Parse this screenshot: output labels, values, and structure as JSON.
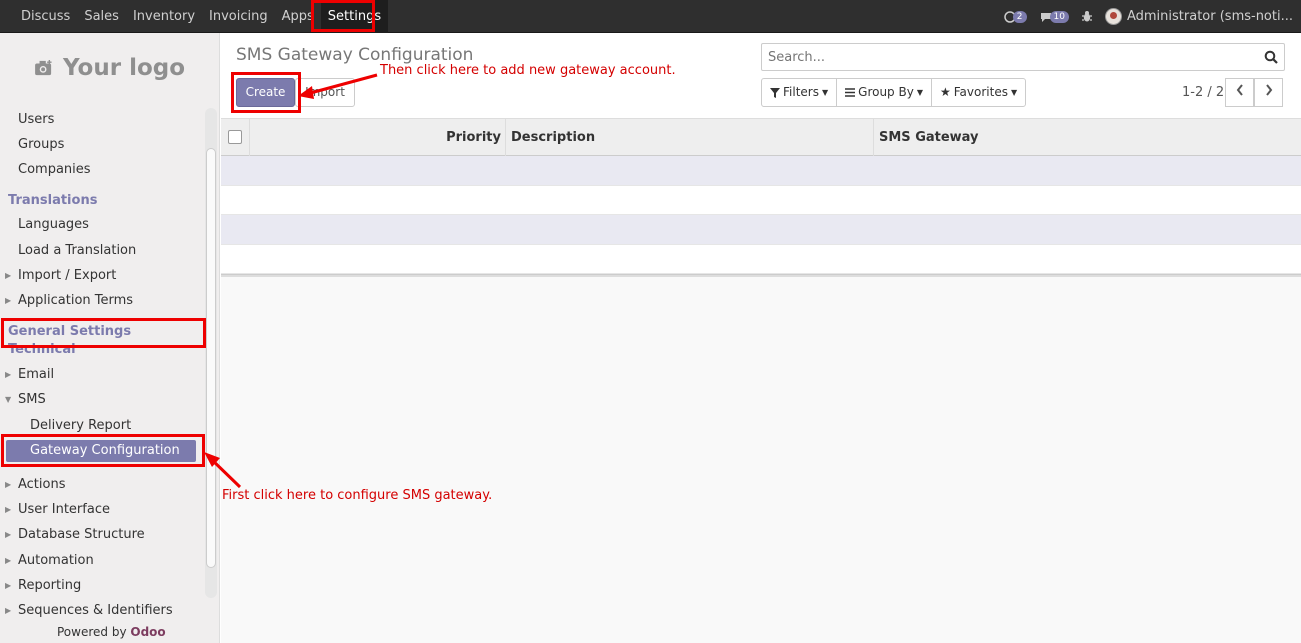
{
  "topbar": {
    "menu": [
      "Discuss",
      "Sales",
      "Inventory",
      "Invoicing",
      "Apps",
      "Settings"
    ],
    "active": "Settings",
    "chat_badge": "2",
    "messages_badge": "10",
    "user": "Administrator (sms-noti..."
  },
  "sidebar": {
    "logo_text": "Your logo",
    "items": [
      {
        "label": "Users",
        "kind": "l1"
      },
      {
        "label": "Groups",
        "kind": "l1"
      },
      {
        "label": "Companies",
        "kind": "l1"
      },
      {
        "label": "Translations",
        "kind": "hdr"
      },
      {
        "label": "Languages",
        "kind": "l1"
      },
      {
        "label": "Load a Translation",
        "kind": "l1"
      },
      {
        "label": "Import / Export",
        "kind": "l1",
        "caret": "right"
      },
      {
        "label": "Application Terms",
        "kind": "l1",
        "caret": "right"
      },
      {
        "label": "General Settings",
        "kind": "hdr"
      },
      {
        "label": "Technical",
        "kind": "hdr"
      },
      {
        "label": "Email",
        "kind": "l1",
        "caret": "right"
      },
      {
        "label": "SMS",
        "kind": "l1",
        "caret": "down"
      },
      {
        "label": "Delivery Report",
        "kind": "l2"
      },
      {
        "label": "Gateway Configuration",
        "kind": "l2",
        "selected": true
      },
      {
        "label": "Actions",
        "kind": "l1",
        "caret": "right"
      },
      {
        "label": "User Interface",
        "kind": "l1",
        "caret": "right"
      },
      {
        "label": "Database Structure",
        "kind": "l1",
        "caret": "right"
      },
      {
        "label": "Automation",
        "kind": "l1",
        "caret": "right"
      },
      {
        "label": "Reporting",
        "kind": "l1",
        "caret": "right"
      },
      {
        "label": "Sequences & Identifiers",
        "kind": "l1",
        "caret": "right"
      }
    ],
    "powered_by": "Powered by",
    "powered_brand": "Odoo"
  },
  "control": {
    "title": "SMS Gateway Configuration",
    "create": "Create",
    "import": "Import",
    "search_placeholder": "Search...",
    "filters": "Filters",
    "group_by": "Group By",
    "favorites": "Favorites",
    "pager": "1-2 / 2"
  },
  "table": {
    "columns": [
      "Priority",
      "Description",
      "SMS Gateway"
    ],
    "rows": [
      {
        "priority": "",
        "description": "",
        "gateway": ""
      },
      {
        "priority": "",
        "description": "",
        "gateway": ""
      }
    ]
  },
  "annotations": {
    "note_create": "Then click here to add new gateway account.",
    "note_gateway": "First click here to configure SMS gateway."
  },
  "colors": {
    "accent": "#7c7bad",
    "annotation": "#e00000"
  }
}
